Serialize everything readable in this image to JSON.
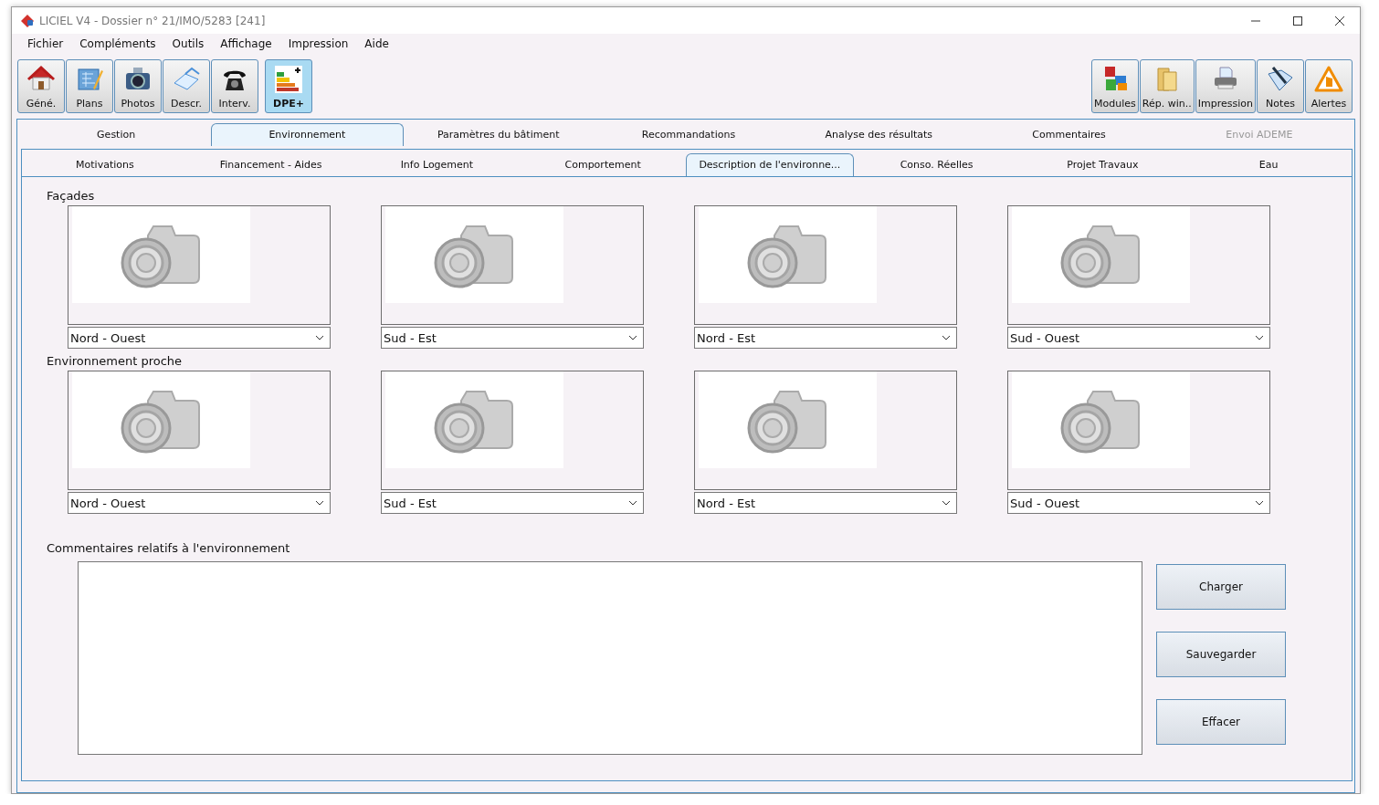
{
  "window": {
    "title": "LICIEL V4 - Dossier n° 21/IMO/5283 [241]"
  },
  "menu": [
    "Fichier",
    "Compléments",
    "Outils",
    "Affichage",
    "Impression",
    "Aide"
  ],
  "toolbar_left": [
    {
      "label": "Géné.",
      "kind": "house",
      "selected": false
    },
    {
      "label": "Plans",
      "kind": "plans",
      "selected": false
    },
    {
      "label": "Photos",
      "kind": "camera",
      "selected": false
    },
    {
      "label": "Descr.",
      "kind": "book",
      "selected": false
    },
    {
      "label": "Interv.",
      "kind": "phone",
      "selected": false
    },
    {
      "label": "DPE+",
      "kind": "dpe",
      "selected": true
    }
  ],
  "toolbar_right": [
    {
      "label": "Modules",
      "kind": "puzzle"
    },
    {
      "label": "Rép. win..",
      "kind": "folder"
    },
    {
      "label": "Impression",
      "kind": "printer"
    },
    {
      "label": "Notes",
      "kind": "notes"
    },
    {
      "label": "Alertes",
      "kind": "warning"
    }
  ],
  "tabs": [
    {
      "label": "Gestion",
      "selected": false,
      "disabled": false
    },
    {
      "label": "Environnement",
      "selected": true,
      "disabled": false
    },
    {
      "label": "Paramètres du bâtiment",
      "selected": false,
      "disabled": false
    },
    {
      "label": "Recommandations",
      "selected": false,
      "disabled": false
    },
    {
      "label": "Analyse des résultats",
      "selected": false,
      "disabled": false
    },
    {
      "label": "Commentaires",
      "selected": false,
      "disabled": false
    },
    {
      "label": "Envoi ADEME",
      "selected": false,
      "disabled": true
    }
  ],
  "subtabs": [
    {
      "label": "Motivations",
      "selected": false
    },
    {
      "label": "Financement  - Aides",
      "selected": false
    },
    {
      "label": "Info Logement",
      "selected": false
    },
    {
      "label": "Comportement",
      "selected": false
    },
    {
      "label": "Description de l'environne...",
      "selected": true
    },
    {
      "label": "Conso. Réelles",
      "selected": false
    },
    {
      "label": "Projet Travaux",
      "selected": false
    },
    {
      "label": "Eau",
      "selected": false
    }
  ],
  "sections": [
    {
      "title": "Façades",
      "photos": [
        {
          "orientation": "Nord - Ouest"
        },
        {
          "orientation": "Sud - Est"
        },
        {
          "orientation": "Nord - Est"
        },
        {
          "orientation": "Sud - Ouest"
        }
      ]
    },
    {
      "title": "Environnement proche",
      "photos": [
        {
          "orientation": "Nord - Ouest"
        },
        {
          "orientation": "Sud - Est"
        },
        {
          "orientation": "Nord - Est"
        },
        {
          "orientation": "Sud - Ouest"
        }
      ]
    }
  ],
  "comments": {
    "label": "Commentaires relatifs à l'environnement"
  },
  "buttons": [
    "Charger",
    "Sauvegarder",
    "Effacer"
  ]
}
